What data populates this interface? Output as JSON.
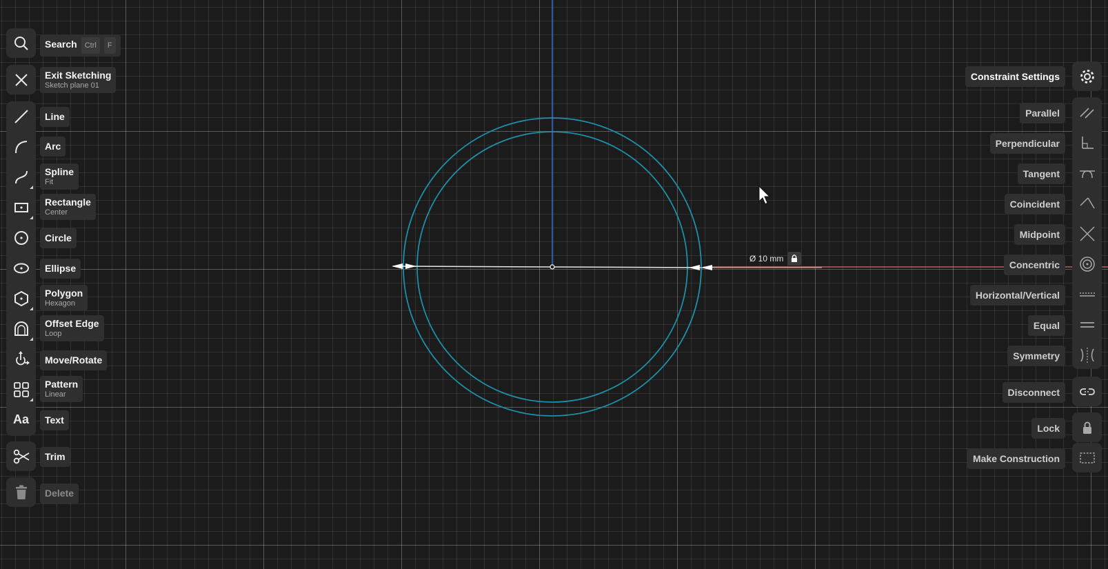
{
  "left_toolbar": {
    "search": {
      "label": "Search",
      "keys": [
        "Ctrl",
        "F"
      ],
      "icon": "search-icon"
    },
    "exit": {
      "label": "Exit Sketching",
      "sub": "Sketch plane 01",
      "icon": "close-icon"
    },
    "line": {
      "label": "Line",
      "icon": "line-icon"
    },
    "arc": {
      "label": "Arc",
      "icon": "arc-icon"
    },
    "spline": {
      "label": "Spline",
      "sub": "Fit",
      "icon": "spline-icon"
    },
    "rectangle": {
      "label": "Rectangle",
      "sub": "Center",
      "icon": "rectangle-icon"
    },
    "circle": {
      "label": "Circle",
      "icon": "circle-icon"
    },
    "ellipse": {
      "label": "Ellipse",
      "icon": "ellipse-icon"
    },
    "polygon": {
      "label": "Polygon",
      "sub": "Hexagon",
      "icon": "polygon-icon"
    },
    "offset": {
      "label": "Offset Edge",
      "sub": "Loop",
      "icon": "offset-edge-icon"
    },
    "move": {
      "label": "Move/Rotate",
      "icon": "move-rotate-icon"
    },
    "pattern": {
      "label": "Pattern",
      "sub": "Linear",
      "icon": "pattern-icon"
    },
    "text": {
      "label": "Text",
      "icon_glyph": "Aa",
      "icon": "text-icon"
    },
    "trim": {
      "label": "Trim",
      "icon": "scissors-icon"
    },
    "delete": {
      "label": "Delete",
      "icon": "trash-icon"
    }
  },
  "right_panel": {
    "header": "Constraint Settings",
    "items": {
      "parallel": "Parallel",
      "perpendicular": "Perpendicular",
      "tangent": "Tangent",
      "coincident": "Coincident",
      "midpoint": "Midpoint",
      "concentric": "Concentric",
      "horizontal_vertical": "Horizontal/Vertical",
      "equal": "Equal",
      "symmetry": "Symmetry",
      "disconnect": "Disconnect",
      "lock": "Lock",
      "make_construction": "Make Construction"
    }
  },
  "dimension": {
    "text": "Ø 10 mm",
    "icon": "lock-icon"
  },
  "colors": {
    "sketch": "#1e8fa8",
    "axis": "#2f6bd6",
    "dimension": "#e0786a",
    "panel": "#2e2e2e"
  }
}
